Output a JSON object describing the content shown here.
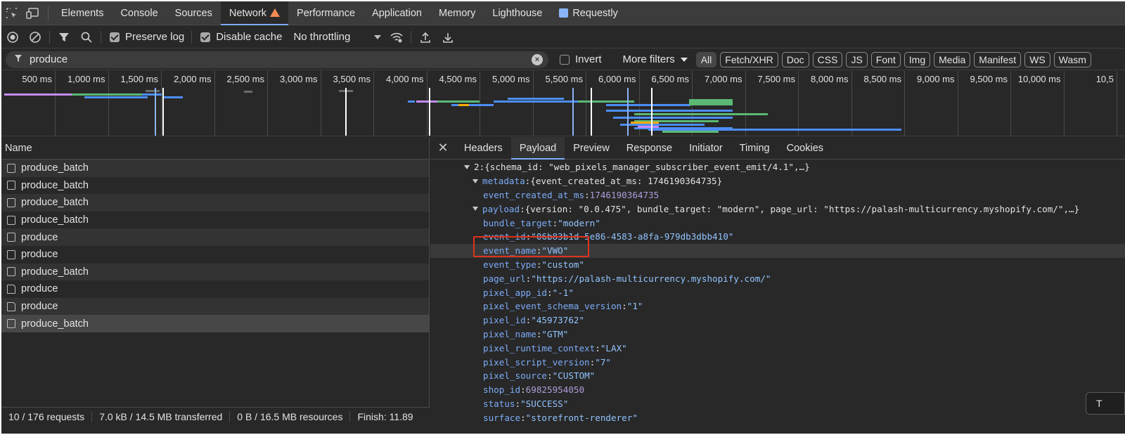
{
  "tabbar": {
    "tabs": [
      {
        "label": "Elements"
      },
      {
        "label": "Console"
      },
      {
        "label": "Sources"
      },
      {
        "label": "Network",
        "active": true,
        "warning": true
      },
      {
        "label": "Performance"
      },
      {
        "label": "Application"
      },
      {
        "label": "Memory"
      },
      {
        "label": "Lighthouse"
      },
      {
        "label": "Requestly"
      }
    ]
  },
  "toolbar": {
    "preserve_log": "Preserve log",
    "disable_cache": "Disable cache",
    "throttling": "No throttling",
    "preserve_log_checked": true,
    "disable_cache_checked": true
  },
  "filter": {
    "value": "produce",
    "invert": "Invert",
    "more_filters": "More filters",
    "chips": [
      "All",
      "Fetch/XHR",
      "Doc",
      "CSS",
      "JS",
      "Font",
      "Img",
      "Media",
      "Manifest",
      "WS",
      "Wasm"
    ]
  },
  "timeline": {
    "ticks": [
      "500 ms",
      "1,000 ms",
      "1,500 ms",
      "2,000 ms",
      "2,500 ms",
      "3,000 ms",
      "3,500 ms",
      "4,000 ms",
      "4,500 ms",
      "5,000 ms",
      "5,500 ms",
      "6,000 ms",
      "6,500 ms",
      "7,000 ms",
      "7,500 ms",
      "8,000 ms",
      "8,500 ms",
      "9,000 ms",
      "9,500 ms",
      "10,000 ms",
      "10,5"
    ]
  },
  "requests": {
    "header": "Name",
    "rows": [
      {
        "name": "produce_batch",
        "icon": "xhr"
      },
      {
        "name": "produce_batch",
        "icon": "xhr"
      },
      {
        "name": "produce_batch",
        "icon": "xhr"
      },
      {
        "name": "produce_batch",
        "icon": "xhr"
      },
      {
        "name": "produce",
        "icon": "xhr"
      },
      {
        "name": "produce",
        "icon": "xhr"
      },
      {
        "name": "produce_batch",
        "icon": "xhr"
      },
      {
        "name": "produce",
        "icon": "doc"
      },
      {
        "name": "produce",
        "icon": "doc"
      },
      {
        "name": "produce_batch",
        "icon": "xhr",
        "selected": true
      }
    ]
  },
  "status": {
    "requests": "10 / 176 requests",
    "transferred": "7.0 kB / 14.5 MB transferred",
    "resources": "0 B / 16.5 MB resources",
    "finish": "Finish: 11.89"
  },
  "detail": {
    "tabs": [
      "Headers",
      "Payload",
      "Preview",
      "Response",
      "Initiator",
      "Timing",
      "Cookies"
    ],
    "active_tab": "Payload",
    "lines": [
      {
        "indent": 0,
        "expander": true,
        "key": "2",
        "text": "{schema_id: \"web_pixels_manager_subscriber_event_emit/4.1\",…}",
        "type": "plain"
      },
      {
        "indent": 1,
        "expander": true,
        "key": "metadata",
        "text": "{event_created_at_ms: 1746190364735}",
        "type": "plain"
      },
      {
        "indent": 2,
        "key": "event_created_at_ms",
        "text": "1746190364735",
        "type": "num"
      },
      {
        "indent": 1,
        "expander": true,
        "key": "payload",
        "text": "{version: \"0.0.475\", bundle_target: \"modern\", page_url: \"https://palash-multicurrency.myshopify.com/\",…}",
        "type": "plain"
      },
      {
        "indent": 2,
        "key": "bundle_target",
        "text": "\"modern\"",
        "type": "str"
      },
      {
        "indent": 2,
        "key": "event_id",
        "text": "\"06b83b1d-5e86-4583-a8fa-979db3dbb410\"",
        "type": "str"
      },
      {
        "indent": 2,
        "key": "event_name",
        "text": "\"VWO\"",
        "type": "str",
        "highlight": true
      },
      {
        "indent": 2,
        "key": "event_type",
        "text": "\"custom\"",
        "type": "str"
      },
      {
        "indent": 2,
        "key": "page_url",
        "text": "\"https://palash-multicurrency.myshopify.com/\"",
        "type": "str"
      },
      {
        "indent": 2,
        "key": "pixel_app_id",
        "text": "\"-1\"",
        "type": "str"
      },
      {
        "indent": 2,
        "key": "pixel_event_schema_version",
        "text": "\"1\"",
        "type": "str"
      },
      {
        "indent": 2,
        "key": "pixel_id",
        "text": "\"45973762\"",
        "type": "str"
      },
      {
        "indent": 2,
        "key": "pixel_name",
        "text": "\"GTM\"",
        "type": "str"
      },
      {
        "indent": 2,
        "key": "pixel_runtime_context",
        "text": "\"LAX\"",
        "type": "str"
      },
      {
        "indent": 2,
        "key": "pixel_script_version",
        "text": "\"7\"",
        "type": "str"
      },
      {
        "indent": 2,
        "key": "pixel_source",
        "text": "\"CUSTOM\"",
        "type": "str"
      },
      {
        "indent": 2,
        "key": "shop_id",
        "text": "69825954050",
        "type": "num"
      },
      {
        "indent": 2,
        "key": "status",
        "text": "\"SUCCESS\"",
        "type": "str"
      },
      {
        "indent": 2,
        "key": "surface",
        "text": "\"storefront-renderer\"",
        "type": "str"
      }
    ]
  },
  "tooltip": "T",
  "colors": {
    "accent": "#7cacf8",
    "highlight_box": "#e0321c",
    "warning": "#f28b54"
  }
}
